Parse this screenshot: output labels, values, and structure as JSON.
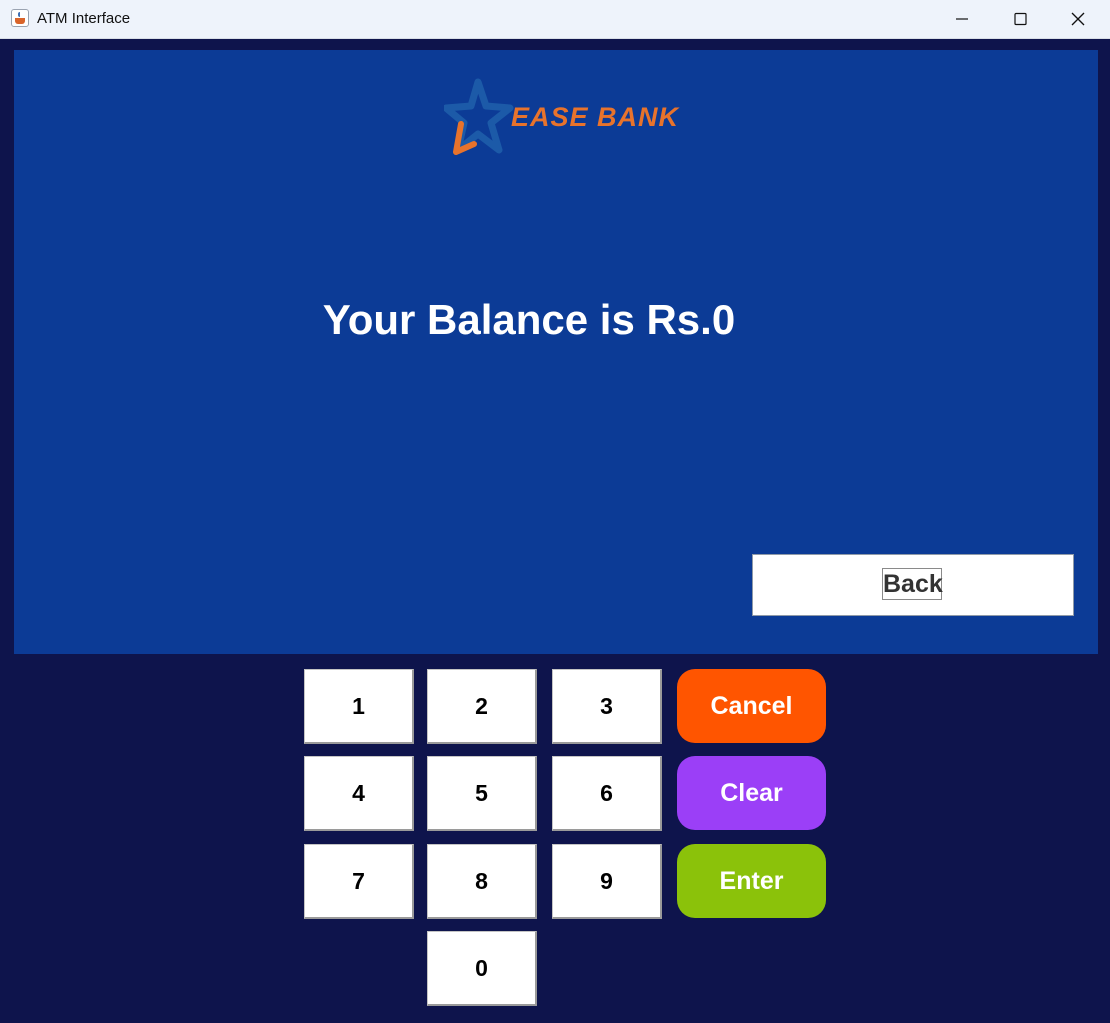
{
  "window": {
    "title": "ATM Interface",
    "icon": "java-cup-icon",
    "controls": [
      "minimize-icon",
      "maximize-icon",
      "close-icon"
    ]
  },
  "logo": {
    "brand": "EASE BANK",
    "icon": "star-icon",
    "colors": {
      "star": "#1c5aa8",
      "accent": "#e8732c"
    }
  },
  "screen": {
    "message": "Your Balance is Rs.0",
    "back_label": "Back",
    "background": "#0c3b96"
  },
  "keypad": {
    "k1": "1",
    "k2": "2",
    "k3": "3",
    "k4": "4",
    "k5": "5",
    "k6": "6",
    "k7": "7",
    "k8": "8",
    "k9": "9",
    "k0": "0"
  },
  "actions": {
    "cancel": "Cancel",
    "clear": "Clear",
    "enter": "Enter",
    "colors": {
      "cancel": "#ff5500",
      "clear": "#9b3ff7",
      "enter": "#8bc20a"
    }
  }
}
